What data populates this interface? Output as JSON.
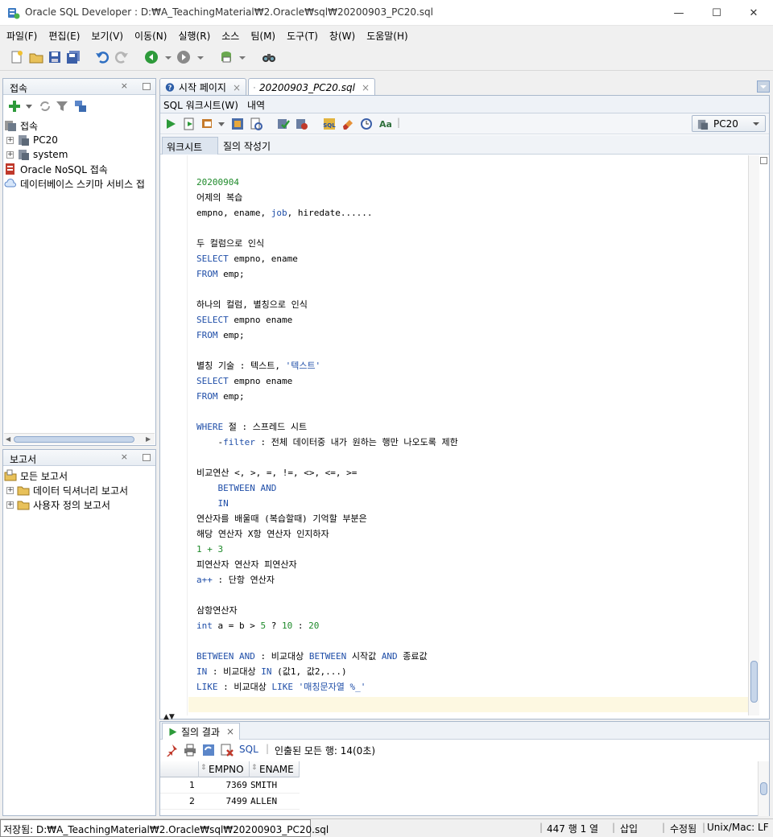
{
  "window": {
    "title": "Oracle SQL Developer : D:₩A_TeachingMaterial₩2.Oracle₩sql₩20200903_PC20.sql",
    "minimize": "—",
    "maximize": "☐",
    "close": "✕"
  },
  "menu": [
    "파일(F)",
    "편집(E)",
    "보기(V)",
    "이동(N)",
    "실행(R)",
    "소스",
    "팀(M)",
    "도구(T)",
    "창(W)",
    "도움말(H)"
  ],
  "connections_panel": {
    "title": "접속",
    "close": "×",
    "root": "접속",
    "items": [
      "PC20",
      "system"
    ],
    "extra": [
      "Oracle NoSQL 접속",
      "데이터베이스 스키마 서비스 접"
    ]
  },
  "reports_panel": {
    "title": "보고서",
    "close": "×",
    "items": [
      "모든 보고서",
      "데이터 딕셔너리 보고서",
      "사용자 정의 보고서"
    ]
  },
  "editor_tabs": {
    "start_page": "시작 페이지",
    "file": "20200903_PC20.sql",
    "close": "×"
  },
  "worksheet_tabs": {
    "sql_worksheet": "SQL 워크시트(W)",
    "history": "내역"
  },
  "connection_select": "PC20",
  "sub_tabs": {
    "worksheet": "워크시트",
    "query_builder": "질의 작성기"
  },
  "code_lines": [
    {
      "t": "20200904",
      "c": "num"
    },
    {
      "t": "어제의 복습",
      "c": ""
    },
    {
      "t": "empno, ename, job, hiredate......",
      "c": "mixed_job"
    },
    {
      "t": "",
      "c": ""
    },
    {
      "t": "두 컬럼으로 인식",
      "c": ""
    },
    {
      "t": "SELECT empno, ename",
      "c": "sel"
    },
    {
      "t": "FROM emp;",
      "c": "from"
    },
    {
      "t": "",
      "c": ""
    },
    {
      "t": "하나의 컬럼, 별칭으로 인식",
      "c": ""
    },
    {
      "t": "SELECT empno ename",
      "c": "sel"
    },
    {
      "t": "FROM emp;",
      "c": "from"
    },
    {
      "t": "",
      "c": ""
    },
    {
      "t": "별칭 기술 : 텍스트, '텍스트'",
      "c": "alias"
    },
    {
      "t": "SELECT empno ename",
      "c": "sel"
    },
    {
      "t": "FROM emp;",
      "c": "from"
    },
    {
      "t": "",
      "c": ""
    },
    {
      "t": "WHERE 절 : 스프레드 시트",
      "c": "where"
    },
    {
      "t": "    -filter : 전체 데이터중 내가 원하는 행만 나오도록 제한",
      "c": "filter"
    },
    {
      "t": "",
      "c": ""
    },
    {
      "t": "비교연산 <, >, =, !=, <>, <=, >=",
      "c": ""
    },
    {
      "t": "    BETWEEN AND",
      "c": "kwline"
    },
    {
      "t": "    IN",
      "c": "kwline"
    },
    {
      "t": "연산자를 배울때 (복습할때) 기억할 부분은",
      "c": ""
    },
    {
      "t": "해당 연산자 X항 연산자 인지하자",
      "c": ""
    },
    {
      "t": "1 + 3",
      "c": "num"
    },
    {
      "t": "피연산자 연산자 피연산자",
      "c": ""
    },
    {
      "t": "a++ : 단항 연산자",
      "c": "app"
    },
    {
      "t": "",
      "c": ""
    },
    {
      "t": "삼항연산자",
      "c": ""
    },
    {
      "t": "int a = b > 5 ? 10 : 20",
      "c": "tern"
    },
    {
      "t": "",
      "c": ""
    },
    {
      "t": "BETWEEN AND : 비교대상 BETWEEN 시작값 AND 종료값",
      "c": "between"
    },
    {
      "t": "IN : 비교대상 IN (값1, 값2,...)",
      "c": "in"
    },
    {
      "t": "LIKE : 비교대상 LIKE '매칭문자열 %_'",
      "c": "like"
    }
  ],
  "results": {
    "tab_title": "질의 결과",
    "close": "×",
    "sql_label": "SQL",
    "fetched": "인출된 모든 행: 14(0초)",
    "columns": [
      "EMPNO",
      "ENAME"
    ],
    "rows": [
      {
        "n": "1",
        "empno": "7369",
        "ename": "SMITH"
      },
      {
        "n": "2",
        "empno": "7499",
        "ename": "ALLEN"
      }
    ]
  },
  "status": {
    "saved": "저장됨: D:₩A_TeachingMaterial₩2.Oracle₩sql₩20200903_PC20.sql",
    "position": "447 행 1 열",
    "mode": "삽입",
    "modified": "수정됨",
    "line_end": "Unix/Mac: LF"
  },
  "colors": {
    "keyword": "#1f4ea8",
    "number": "#1e8a2a",
    "current_line": "#fdf8e1",
    "panel_border": "#a9b8cc"
  }
}
